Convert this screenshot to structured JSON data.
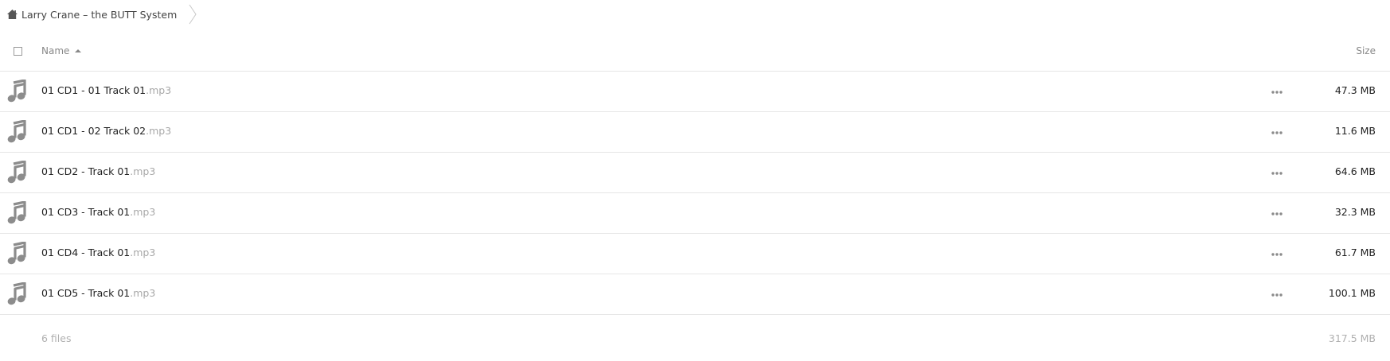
{
  "breadcrumb": {
    "folder": "Larry Crane – the BUTT System"
  },
  "table": {
    "header": {
      "name": "Name",
      "size": "Size"
    },
    "files": [
      {
        "name": "01 CD1 - 01 Track 01",
        "ext": ".mp3",
        "size": "47.3 MB",
        "icon": "music-note-icon"
      },
      {
        "name": "01 CD1 - 02 Track 02",
        "ext": ".mp3",
        "size": "11.6 MB",
        "icon": "music-note-icon"
      },
      {
        "name": "01 CD2 - Track 01",
        "ext": ".mp3",
        "size": "64.6 MB",
        "icon": "music-note-icon"
      },
      {
        "name": "01 CD3 - Track 01",
        "ext": ".mp3",
        "size": "32.3 MB",
        "icon": "music-note-icon"
      },
      {
        "name": "01 CD4 - Track 01",
        "ext": ".mp3",
        "size": "61.7 MB",
        "icon": "music-note-icon"
      },
      {
        "name": "01 CD5 - Track 01",
        "ext": ".mp3",
        "size": "100.1 MB",
        "icon": "music-note-icon"
      }
    ],
    "summary": {
      "count": "6 files",
      "total_size": "317.5 MB"
    }
  },
  "colors": {
    "icon_gray": "#8c8c8c",
    "divider": "#e6e6e6",
    "muted_text": "#b0b0b0"
  }
}
